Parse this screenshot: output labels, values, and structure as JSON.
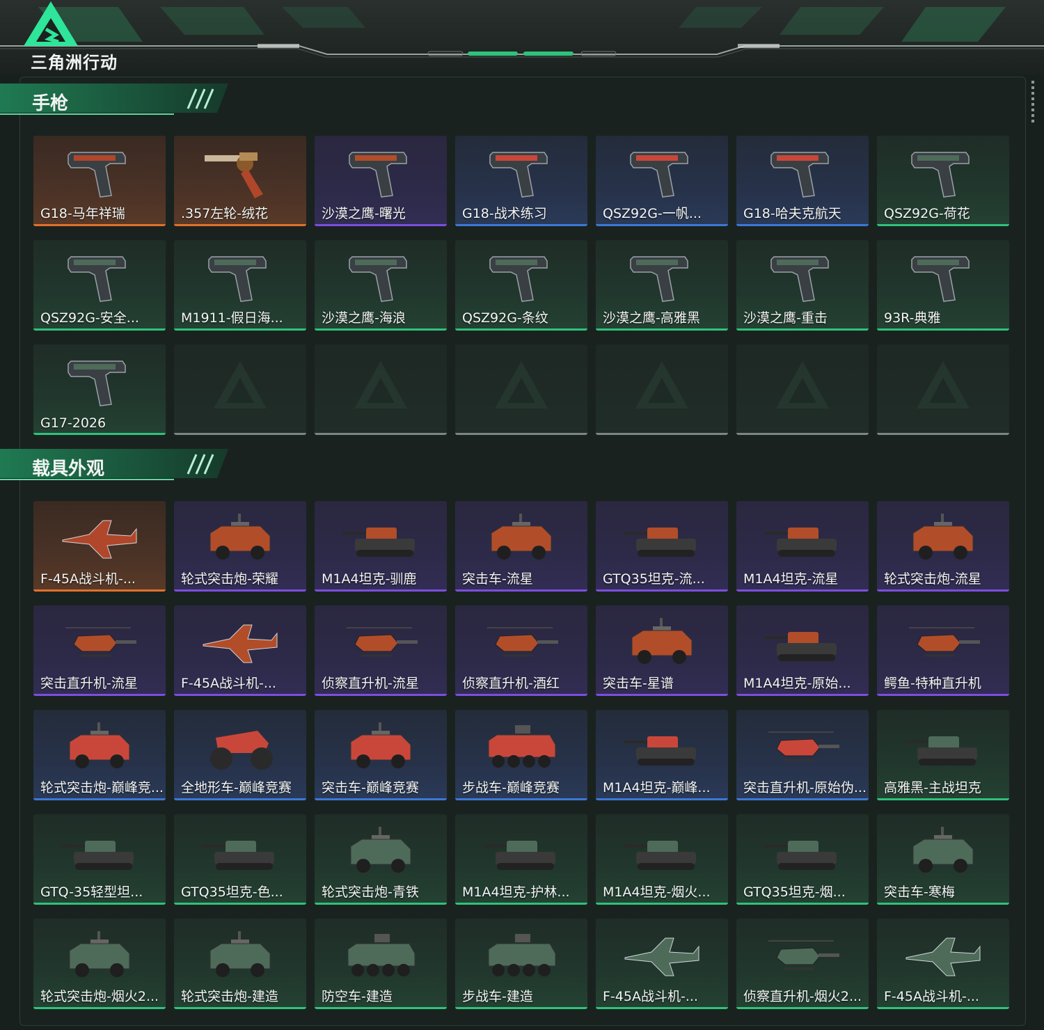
{
  "header": {
    "logo_text": "三角洲行动"
  },
  "sections": [
    {
      "title": "手枪",
      "items": [
        {
          "label": "G18-马年祥瑞",
          "rarity": "orange",
          "icon": "pistol-icon"
        },
        {
          "label": ".357左轮-绒花",
          "rarity": "orange",
          "icon": "revolver-icon"
        },
        {
          "label": "沙漠之鹰-曙光",
          "rarity": "purple",
          "icon": "pistol-icon"
        },
        {
          "label": "G18-战术练习",
          "rarity": "blue",
          "icon": "pistol-icon"
        },
        {
          "label": "QSZ92G-一帆...",
          "rarity": "blue",
          "icon": "pistol-icon"
        },
        {
          "label": "G18-哈夫克航天",
          "rarity": "blue",
          "icon": "pistol-icon"
        },
        {
          "label": "QSZ92G-荷花",
          "rarity": "green",
          "icon": "pistol-icon"
        },
        {
          "label": "QSZ92G-安全...",
          "rarity": "green",
          "icon": "pistol-icon"
        },
        {
          "label": "M1911-假日海...",
          "rarity": "green",
          "icon": "pistol-icon"
        },
        {
          "label": "沙漠之鹰-海浪",
          "rarity": "green",
          "icon": "pistol-icon"
        },
        {
          "label": "QSZ92G-条纹",
          "rarity": "green",
          "icon": "pistol-icon"
        },
        {
          "label": "沙漠之鹰-高雅黑",
          "rarity": "green",
          "icon": "pistol-icon"
        },
        {
          "label": "沙漠之鹰-重击",
          "rarity": "green",
          "icon": "pistol-icon"
        },
        {
          "label": "93R-典雅",
          "rarity": "green",
          "icon": "pistol-icon"
        },
        {
          "label": "G17-2026",
          "rarity": "green",
          "icon": "pistol-icon"
        },
        {
          "label": "",
          "rarity": "empty",
          "icon": "delta-watermark-icon"
        },
        {
          "label": "",
          "rarity": "empty",
          "icon": "delta-watermark-icon"
        },
        {
          "label": "",
          "rarity": "empty",
          "icon": "delta-watermark-icon"
        },
        {
          "label": "",
          "rarity": "empty",
          "icon": "delta-watermark-icon"
        },
        {
          "label": "",
          "rarity": "empty",
          "icon": "delta-watermark-icon"
        },
        {
          "label": "",
          "rarity": "empty",
          "icon": "delta-watermark-icon"
        }
      ]
    },
    {
      "title": "载具外观",
      "items": [
        {
          "label": "F-45A战斗机-...",
          "rarity": "orange",
          "icon": "jet-icon"
        },
        {
          "label": "轮式突击炮-荣耀",
          "rarity": "purple",
          "icon": "armored-car-icon"
        },
        {
          "label": "M1A4坦克-驯鹿",
          "rarity": "purple",
          "icon": "tank-icon"
        },
        {
          "label": "突击车-流星",
          "rarity": "purple",
          "icon": "armored-car-icon"
        },
        {
          "label": "GTQ35坦克-流...",
          "rarity": "purple",
          "icon": "tank-icon"
        },
        {
          "label": "M1A4坦克-流星",
          "rarity": "purple",
          "icon": "tank-icon"
        },
        {
          "label": "轮式突击炮-流星",
          "rarity": "purple",
          "icon": "armored-car-icon"
        },
        {
          "label": "突击直升机-流星",
          "rarity": "purple",
          "icon": "helicopter-icon"
        },
        {
          "label": "F-45A战斗机-...",
          "rarity": "purple",
          "icon": "jet-icon"
        },
        {
          "label": "侦察直升机-流星",
          "rarity": "purple",
          "icon": "helicopter-icon"
        },
        {
          "label": "侦察直升机-酒红",
          "rarity": "purple",
          "icon": "helicopter-icon"
        },
        {
          "label": "突击车-星谱",
          "rarity": "purple",
          "icon": "armored-car-icon"
        },
        {
          "label": "M1A4坦克-原始...",
          "rarity": "purple",
          "icon": "tank-icon"
        },
        {
          "label": "鳄鱼-特种直升机",
          "rarity": "purple",
          "icon": "helicopter-icon"
        },
        {
          "label": "轮式突击炮-巅峰竞...",
          "rarity": "blue",
          "icon": "armored-car-icon"
        },
        {
          "label": "全地形车-巅峰竞赛",
          "rarity": "blue",
          "icon": "atv-icon"
        },
        {
          "label": "突击车-巅峰竞赛",
          "rarity": "blue",
          "icon": "armored-car-icon"
        },
        {
          "label": "步战车-巅峰竞赛",
          "rarity": "blue",
          "icon": "ifv-icon"
        },
        {
          "label": "M1A4坦克-巅峰...",
          "rarity": "blue",
          "icon": "tank-icon"
        },
        {
          "label": "突击直升机-原始伪...",
          "rarity": "blue",
          "icon": "helicopter-icon"
        },
        {
          "label": "高雅黑-主战坦克",
          "rarity": "green",
          "icon": "tank-icon"
        },
        {
          "label": "GTQ-35轻型坦...",
          "rarity": "green",
          "icon": "tank-icon"
        },
        {
          "label": "GTQ35坦克-色...",
          "rarity": "green",
          "icon": "tank-icon"
        },
        {
          "label": "轮式突击炮-青铁",
          "rarity": "green",
          "icon": "armored-car-icon"
        },
        {
          "label": "M1A4坦克-护林...",
          "rarity": "green",
          "icon": "tank-icon"
        },
        {
          "label": "M1A4坦克-烟火...",
          "rarity": "green",
          "icon": "tank-icon"
        },
        {
          "label": "GTQ35坦克-烟...",
          "rarity": "green",
          "icon": "tank-icon"
        },
        {
          "label": "突击车-寒梅",
          "rarity": "green",
          "icon": "armored-car-icon"
        },
        {
          "label": "轮式突击炮-烟火2...",
          "rarity": "green",
          "icon": "armored-car-icon"
        },
        {
          "label": "轮式突击炮-建造",
          "rarity": "green",
          "icon": "armored-car-icon"
        },
        {
          "label": "防空车-建造",
          "rarity": "green",
          "icon": "ifv-icon"
        },
        {
          "label": "步战车-建造",
          "rarity": "green",
          "icon": "ifv-icon"
        },
        {
          "label": "F-45A战斗机-...",
          "rarity": "green",
          "icon": "jet-icon"
        },
        {
          "label": "侦察直升机-烟火2...",
          "rarity": "green",
          "icon": "helicopter-icon"
        },
        {
          "label": "F-45A战斗机-...",
          "rarity": "green",
          "icon": "jet-icon"
        }
      ]
    }
  ],
  "colors": {
    "accent": "#2fc27c",
    "rarity_orange": "#e0712c",
    "rarity_purple": "#7b4ee0",
    "rarity_blue": "#3d78d8",
    "rarity_green": "#2fc27c"
  }
}
